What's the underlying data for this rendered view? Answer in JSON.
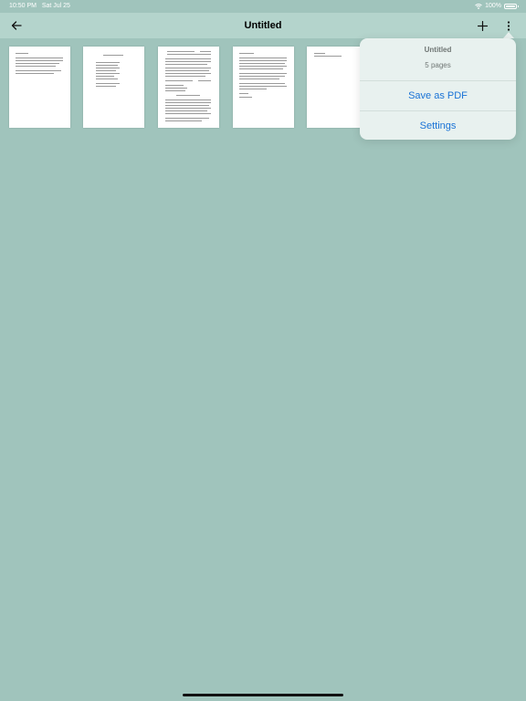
{
  "status_bar": {
    "time": "10:50 PM",
    "date": "Sat Jul 25",
    "battery": "100%",
    "wifi_icon": "wifi-icon",
    "battery_icon": "battery-icon"
  },
  "nav_bar": {
    "title": "Untitled",
    "back_icon": "arrow-left-icon",
    "add_icon": "plus-icon",
    "more_icon": "more-vertical-icon"
  },
  "pages": [
    {
      "name": "page-1"
    },
    {
      "name": "page-2"
    },
    {
      "name": "page-3"
    },
    {
      "name": "page-4"
    },
    {
      "name": "page-5"
    }
  ],
  "popover": {
    "title": "Untitled",
    "subtitle": "5 pages",
    "items": [
      {
        "label": "Save as PDF"
      },
      {
        "label": "Settings"
      }
    ]
  },
  "colors": {
    "background": "#a0c4bc",
    "nav_bar": "#b4d4cc",
    "popover": "#e8f1ef",
    "accent": "#1a73d6"
  }
}
